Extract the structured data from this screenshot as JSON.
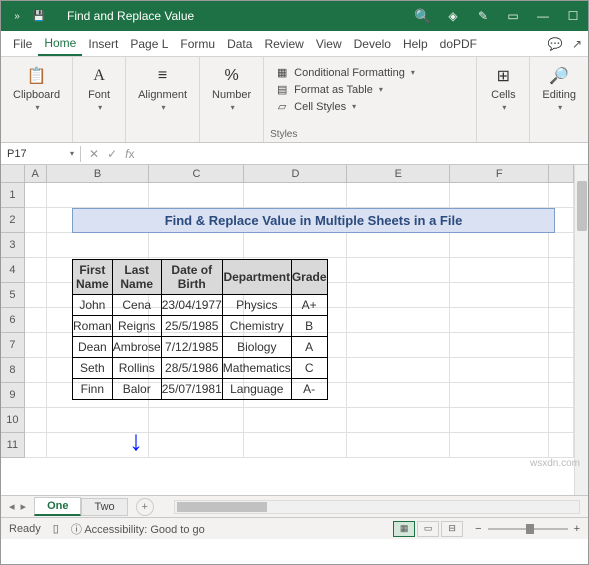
{
  "titlebar": {
    "title": "Find and Replace Value "
  },
  "ribbon_tabs": [
    "File",
    "Home",
    "Insert",
    "Page L",
    "Formu",
    "Data",
    "Review",
    "View",
    "Develo",
    "Help",
    "doPDF"
  ],
  "active_tab": "Home",
  "groups": {
    "clipboard": {
      "btn": "Clipboard",
      "label": ""
    },
    "font": {
      "btn": "Font",
      "label": ""
    },
    "alignment": {
      "btn": "Alignment",
      "label": ""
    },
    "number": {
      "btn": "Number",
      "label": ""
    },
    "styles": {
      "cond": "Conditional Formatting",
      "table": "Format as Table",
      "cell": "Cell Styles",
      "label": "Styles"
    },
    "cells": {
      "btn": "Cells",
      "label": ""
    },
    "editing": {
      "btn": "Editing",
      "label": ""
    }
  },
  "namebox": "P17",
  "formula": "",
  "columns": [
    "A",
    "B",
    "C",
    "D",
    "E",
    "F"
  ],
  "rows": [
    "1",
    "2",
    "3",
    "4",
    "5",
    "6",
    "7",
    "8",
    "9",
    "10",
    "11"
  ],
  "col_widths": {
    "A": 22,
    "B": 104,
    "C": 96,
    "D": 104,
    "E": 104,
    "F": 100,
    "rest": 25
  },
  "title_cell": "Find & Replace Value in Multiple Sheets in a File",
  "table": {
    "headers": [
      "First Name",
      "Last Name",
      "Date of Birth",
      "Department",
      "Grade"
    ],
    "rows": [
      [
        "John",
        "Cena",
        "23/04/1977",
        "Physics",
        "A+"
      ],
      [
        "Roman",
        "Reigns",
        "25/5/1985",
        "Chemistry",
        "B"
      ],
      [
        "Dean",
        "Ambrose",
        "7/12/1985",
        "Biology",
        "A"
      ],
      [
        "Seth",
        "Rollins",
        "28/5/1986",
        "Mathematics",
        "C"
      ],
      [
        "Finn",
        "Balor",
        "25/07/1981",
        "Language",
        "A-"
      ]
    ]
  },
  "sheet_tabs": [
    "One",
    "Two"
  ],
  "active_sheet": "One",
  "status": {
    "ready": "Ready",
    "access": "Accessibility: Good to go",
    "zoom": ""
  },
  "watermark": "wsxdn.com"
}
